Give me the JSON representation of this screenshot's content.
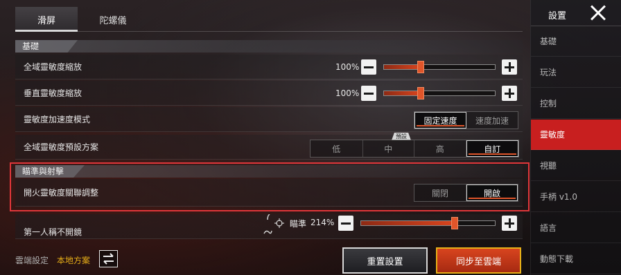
{
  "tabs": [
    {
      "label": "滑屏",
      "active": true
    },
    {
      "label": "陀螺儀",
      "active": false
    }
  ],
  "sections": {
    "basic": "基礎",
    "aim_fire": "瞄準與射擊"
  },
  "rows": {
    "global_sens": {
      "label": "全域靈敏度縮放",
      "value_text": "100%",
      "level": 0.33
    },
    "vertical_sens": {
      "label": "垂直靈敏度縮放",
      "value_text": "100%",
      "level": 0.33
    },
    "accel_mode": {
      "label": "靈敏度加速度模式",
      "options": [
        "固定速度",
        "速度加速"
      ],
      "selected": "固定速度"
    },
    "preset": {
      "label": "全域靈敏度預設方案",
      "badge": "預設",
      "options": [
        "低",
        "中",
        "高",
        "自訂"
      ],
      "selected": "自訂"
    },
    "fire_link": {
      "label": "開火靈敏度關聯調整",
      "options": [
        "關閉",
        "開啟"
      ],
      "selected": "開啟"
    },
    "first_person": {
      "label": "第一人稱不開鏡",
      "aim_label": "瞄準",
      "value_text": "214%",
      "level": 0.7
    }
  },
  "sidebar": {
    "title": "設置",
    "items": [
      "基礎",
      "玩法",
      "控制",
      "靈敏度",
      "視聽",
      "手柄 v1.0",
      "語言",
      "動態下載"
    ],
    "selected": "靈敏度"
  },
  "bottom": {
    "cloud_label": "雲端設定",
    "cloud_value": "本地方案",
    "reset_label": "重置設置",
    "sync_label": "同步至雲端"
  },
  "colors": {
    "accent": "#d8441e",
    "sidebar_selected": "#c81f1f",
    "highlight_border": "#e0363a",
    "cloud_value": "#e8b018"
  }
}
